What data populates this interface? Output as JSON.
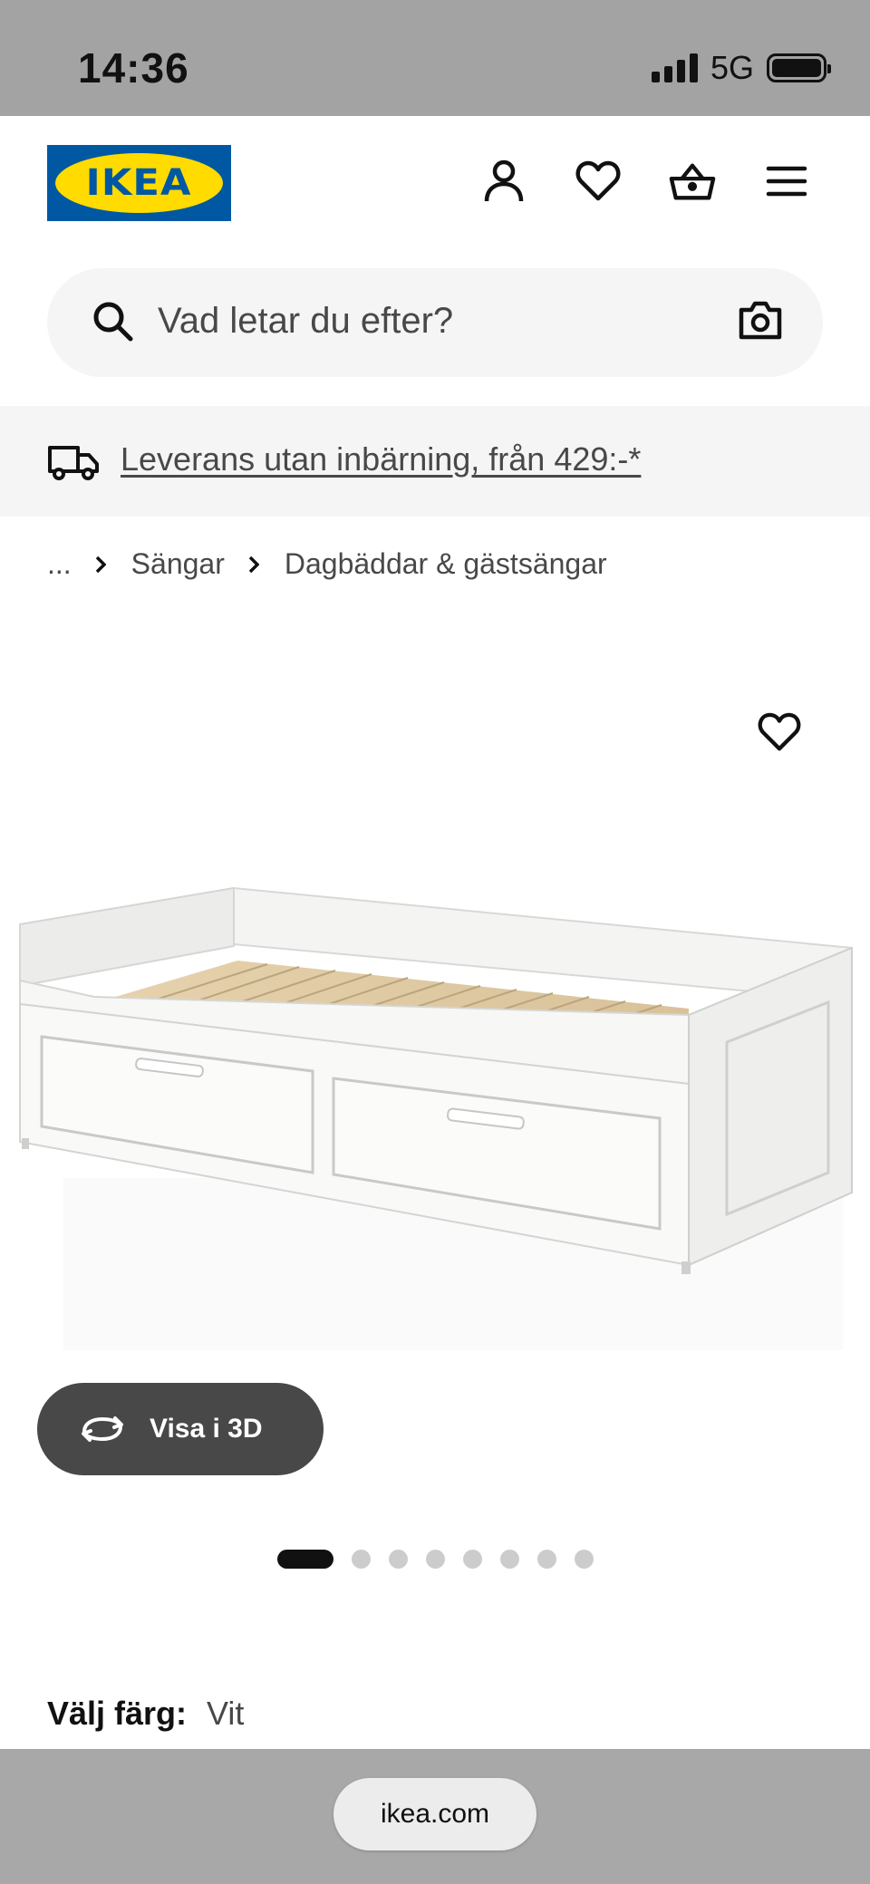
{
  "status_bar": {
    "time": "14:36",
    "network": "5G"
  },
  "header": {
    "logo_text": "IKEA",
    "icons": [
      "account-icon",
      "heart-icon",
      "basket-icon",
      "menu-icon"
    ]
  },
  "search": {
    "placeholder": "Vad letar du efter?"
  },
  "delivery": {
    "text": "Leverans utan inbärning, från 429:-*"
  },
  "breadcrumb": {
    "ellipsis": "...",
    "items": [
      "Sängar",
      "Dagbäddar & gästsängar"
    ]
  },
  "gallery": {
    "view_3d_label": "Visa i 3D",
    "total_images": 8,
    "active_index": 0
  },
  "product": {
    "color_label": "Välj färg:",
    "color_value": "Vit"
  },
  "browser": {
    "url": "ikea.com"
  },
  "colors": {
    "ikea_blue": "#0058a3",
    "ikea_yellow": "#ffdb00",
    "banner_gray": "#f5f5f5",
    "button_dark": "#484848"
  }
}
